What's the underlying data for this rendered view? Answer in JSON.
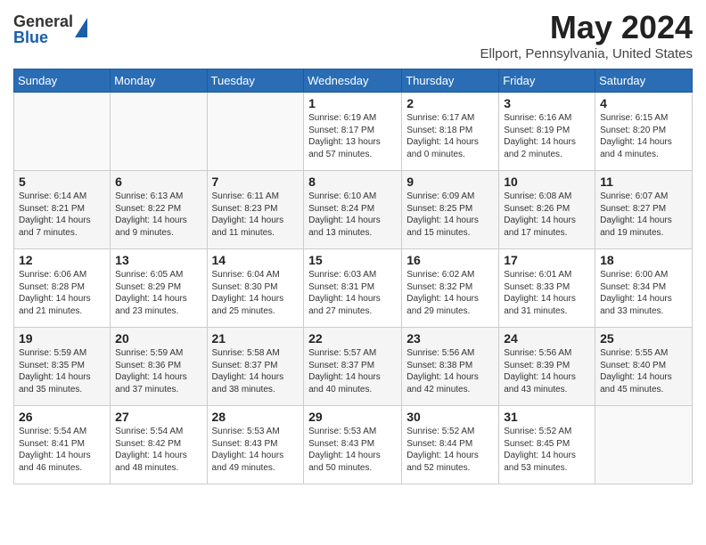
{
  "logo": {
    "general": "General",
    "blue": "Blue"
  },
  "title": {
    "month_year": "May 2024",
    "location": "Ellport, Pennsylvania, United States"
  },
  "headers": [
    "Sunday",
    "Monday",
    "Tuesday",
    "Wednesday",
    "Thursday",
    "Friday",
    "Saturday"
  ],
  "weeks": [
    [
      {
        "day": "",
        "info": ""
      },
      {
        "day": "",
        "info": ""
      },
      {
        "day": "",
        "info": ""
      },
      {
        "day": "1",
        "info": "Sunrise: 6:19 AM\nSunset: 8:17 PM\nDaylight: 13 hours and 57 minutes."
      },
      {
        "day": "2",
        "info": "Sunrise: 6:17 AM\nSunset: 8:18 PM\nDaylight: 14 hours and 0 minutes."
      },
      {
        "day": "3",
        "info": "Sunrise: 6:16 AM\nSunset: 8:19 PM\nDaylight: 14 hours and 2 minutes."
      },
      {
        "day": "4",
        "info": "Sunrise: 6:15 AM\nSunset: 8:20 PM\nDaylight: 14 hours and 4 minutes."
      }
    ],
    [
      {
        "day": "5",
        "info": "Sunrise: 6:14 AM\nSunset: 8:21 PM\nDaylight: 14 hours and 7 minutes."
      },
      {
        "day": "6",
        "info": "Sunrise: 6:13 AM\nSunset: 8:22 PM\nDaylight: 14 hours and 9 minutes."
      },
      {
        "day": "7",
        "info": "Sunrise: 6:11 AM\nSunset: 8:23 PM\nDaylight: 14 hours and 11 minutes."
      },
      {
        "day": "8",
        "info": "Sunrise: 6:10 AM\nSunset: 8:24 PM\nDaylight: 14 hours and 13 minutes."
      },
      {
        "day": "9",
        "info": "Sunrise: 6:09 AM\nSunset: 8:25 PM\nDaylight: 14 hours and 15 minutes."
      },
      {
        "day": "10",
        "info": "Sunrise: 6:08 AM\nSunset: 8:26 PM\nDaylight: 14 hours and 17 minutes."
      },
      {
        "day": "11",
        "info": "Sunrise: 6:07 AM\nSunset: 8:27 PM\nDaylight: 14 hours and 19 minutes."
      }
    ],
    [
      {
        "day": "12",
        "info": "Sunrise: 6:06 AM\nSunset: 8:28 PM\nDaylight: 14 hours and 21 minutes."
      },
      {
        "day": "13",
        "info": "Sunrise: 6:05 AM\nSunset: 8:29 PM\nDaylight: 14 hours and 23 minutes."
      },
      {
        "day": "14",
        "info": "Sunrise: 6:04 AM\nSunset: 8:30 PM\nDaylight: 14 hours and 25 minutes."
      },
      {
        "day": "15",
        "info": "Sunrise: 6:03 AM\nSunset: 8:31 PM\nDaylight: 14 hours and 27 minutes."
      },
      {
        "day": "16",
        "info": "Sunrise: 6:02 AM\nSunset: 8:32 PM\nDaylight: 14 hours and 29 minutes."
      },
      {
        "day": "17",
        "info": "Sunrise: 6:01 AM\nSunset: 8:33 PM\nDaylight: 14 hours and 31 minutes."
      },
      {
        "day": "18",
        "info": "Sunrise: 6:00 AM\nSunset: 8:34 PM\nDaylight: 14 hours and 33 minutes."
      }
    ],
    [
      {
        "day": "19",
        "info": "Sunrise: 5:59 AM\nSunset: 8:35 PM\nDaylight: 14 hours and 35 minutes."
      },
      {
        "day": "20",
        "info": "Sunrise: 5:59 AM\nSunset: 8:36 PM\nDaylight: 14 hours and 37 minutes."
      },
      {
        "day": "21",
        "info": "Sunrise: 5:58 AM\nSunset: 8:37 PM\nDaylight: 14 hours and 38 minutes."
      },
      {
        "day": "22",
        "info": "Sunrise: 5:57 AM\nSunset: 8:37 PM\nDaylight: 14 hours and 40 minutes."
      },
      {
        "day": "23",
        "info": "Sunrise: 5:56 AM\nSunset: 8:38 PM\nDaylight: 14 hours and 42 minutes."
      },
      {
        "day": "24",
        "info": "Sunrise: 5:56 AM\nSunset: 8:39 PM\nDaylight: 14 hours and 43 minutes."
      },
      {
        "day": "25",
        "info": "Sunrise: 5:55 AM\nSunset: 8:40 PM\nDaylight: 14 hours and 45 minutes."
      }
    ],
    [
      {
        "day": "26",
        "info": "Sunrise: 5:54 AM\nSunset: 8:41 PM\nDaylight: 14 hours and 46 minutes."
      },
      {
        "day": "27",
        "info": "Sunrise: 5:54 AM\nSunset: 8:42 PM\nDaylight: 14 hours and 48 minutes."
      },
      {
        "day": "28",
        "info": "Sunrise: 5:53 AM\nSunset: 8:43 PM\nDaylight: 14 hours and 49 minutes."
      },
      {
        "day": "29",
        "info": "Sunrise: 5:53 AM\nSunset: 8:43 PM\nDaylight: 14 hours and 50 minutes."
      },
      {
        "day": "30",
        "info": "Sunrise: 5:52 AM\nSunset: 8:44 PM\nDaylight: 14 hours and 52 minutes."
      },
      {
        "day": "31",
        "info": "Sunrise: 5:52 AM\nSunset: 8:45 PM\nDaylight: 14 hours and 53 minutes."
      },
      {
        "day": "",
        "info": ""
      }
    ]
  ]
}
